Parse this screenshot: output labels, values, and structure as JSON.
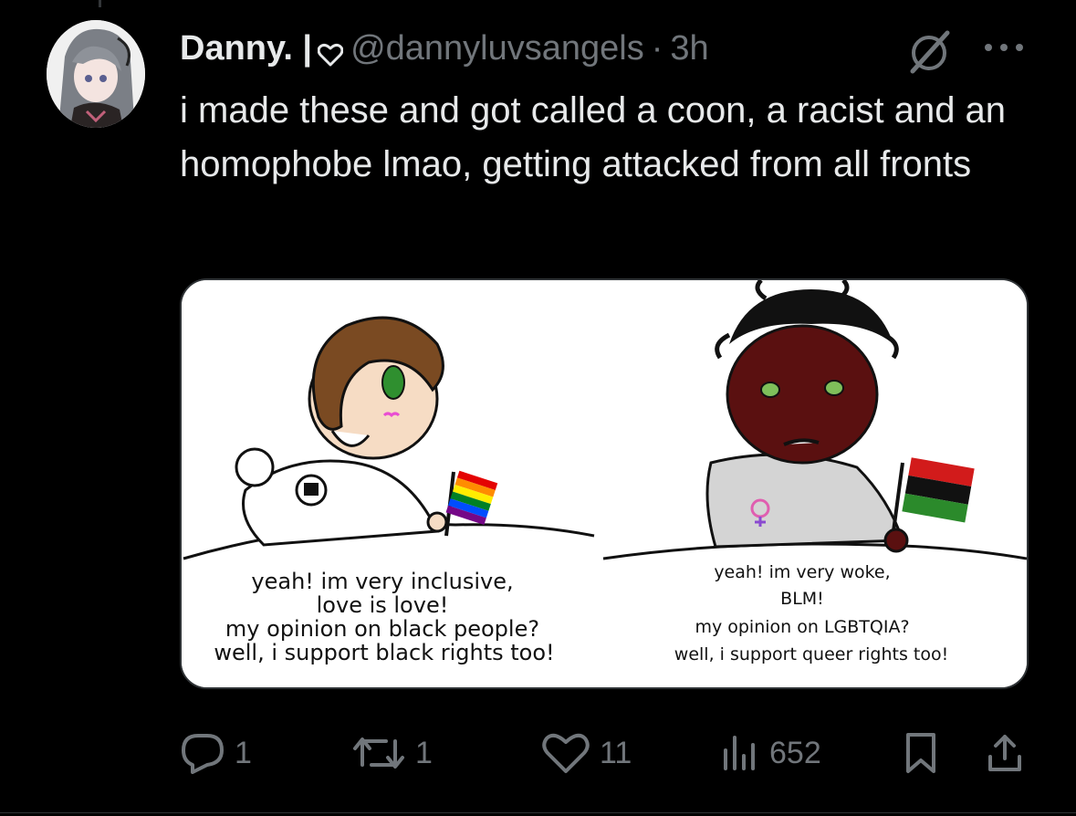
{
  "tweet": {
    "author_name": "Danny. |",
    "handle": "@dannyluvsangels",
    "separator": "·",
    "time": "3h",
    "text": "i made these and got called a coon, a racist and an homophobe lmao, getting attacked from all fronts"
  },
  "media": {
    "left_panel": {
      "caption_lines": [
        "yeah! im very inclusive,",
        "love is love!",
        "my opinion on black people?",
        "well, i support black rights too!"
      ]
    },
    "right_panel": {
      "caption_lines": [
        "yeah! im very woke,",
        "BLM!",
        "my opinion on LGBTQIA?",
        "well, i support queer rights too!"
      ]
    }
  },
  "actions": {
    "replies": "1",
    "reposts": "1",
    "likes": "11",
    "views": "652"
  },
  "colors": {
    "background": "#000000",
    "text": "#e7e9ea",
    "muted": "#71767b"
  },
  "icons": [
    "heart-icon",
    "grok-icon",
    "more-icon",
    "reply-icon",
    "repost-icon",
    "like-icon",
    "views-icon",
    "bookmark-icon",
    "share-icon"
  ]
}
